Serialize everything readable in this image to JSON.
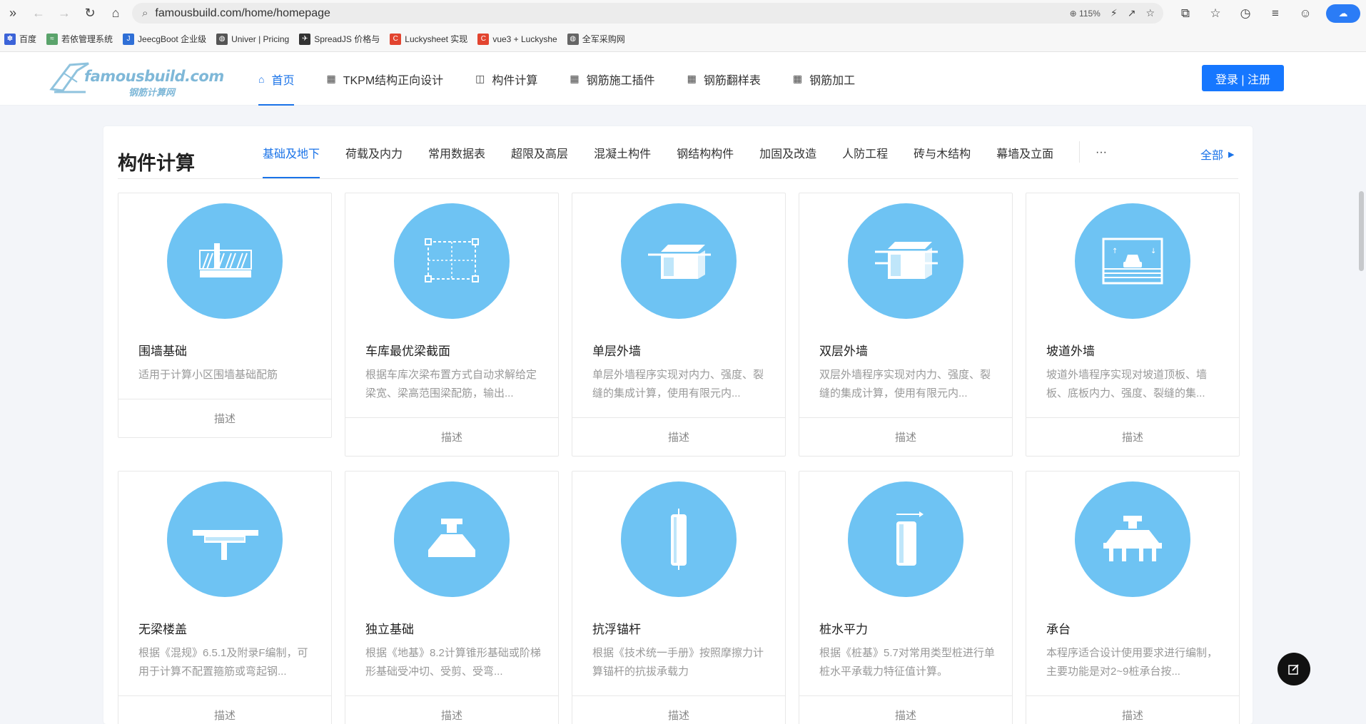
{
  "browser": {
    "url": "famousbuild.com/home/homepage",
    "zoom": "115%"
  },
  "bookmarks": [
    {
      "label": "百度",
      "color": "#3b63d8"
    },
    {
      "label": "若依管理系统",
      "color": "#5aa36b"
    },
    {
      "label": "JeecgBoot 企业级",
      "color": "#2f6fd6"
    },
    {
      "label": "Univer | Pricing",
      "color": "#555555"
    },
    {
      "label": "SpreadJS 价格与",
      "color": "#333333"
    },
    {
      "label": "Luckysheet 实现",
      "color": "#e2442f"
    },
    {
      "label": "vue3 + Luckyshe",
      "color": "#e2442f"
    },
    {
      "label": "全军采购网",
      "color": "#666666"
    }
  ],
  "site": {
    "logo_text": "famousbuild.com",
    "logo_sub": "钢筋计算网",
    "nav": [
      {
        "label": "首页",
        "icon": "home-icon",
        "active": true
      },
      {
        "label": "TKPM结构正向设计",
        "icon": "grid-icon"
      },
      {
        "label": "构件计算",
        "icon": "frame-icon"
      },
      {
        "label": "钢筋施工插件",
        "icon": "grid-icon"
      },
      {
        "label": "钢筋翻样表",
        "icon": "grid-icon"
      },
      {
        "label": "钢筋加工",
        "icon": "grid-icon"
      }
    ],
    "login_label": "登录 | 注册"
  },
  "panel": {
    "title": "构件计算",
    "tabs": [
      "基础及地下",
      "荷载及内力",
      "常用数据表",
      "超限及高层",
      "混凝土构件",
      "钢结构构件",
      "加固及改造",
      "人防工程",
      "砖与木结构",
      "幕墙及立面"
    ],
    "active_tab": 0,
    "more_label": "···",
    "all_label": "全部",
    "cards": [
      {
        "title": "围墙基础",
        "desc": "适用于计算小区围墙基础配筋",
        "foot": "描述",
        "icon": "wall-foundation-icon"
      },
      {
        "title": "车库最优梁截面",
        "desc": "根据车库次梁布置方式自动求解给定梁宽、梁高范围梁配筋，输出...",
        "foot": "描述",
        "icon": "beam-section-icon"
      },
      {
        "title": "单层外墙",
        "desc": "单层外墙程序实现对内力、强度、裂缝的集成计算，使用有限元内...",
        "foot": "描述",
        "icon": "single-wall-icon"
      },
      {
        "title": "双层外墙",
        "desc": "双层外墙程序实现对内力、强度、裂缝的集成计算，使用有限元内...",
        "foot": "描述",
        "icon": "double-wall-icon"
      },
      {
        "title": "坡道外墙",
        "desc": "坡道外墙程序实现对坡道顶板、墙板、底板内力、强度、裂缝的集...",
        "foot": "描述",
        "icon": "ramp-wall-icon"
      },
      {
        "title": "无梁楼盖",
        "desc": "根据《混规》6.5.1及附录F编制，可用于计算不配置箍筋或弯起钢...",
        "foot": "描述",
        "icon": "flat-slab-icon"
      },
      {
        "title": "独立基础",
        "desc": "根据《地基》8.2计算锥形基础或阶梯形基础受冲切、受剪、受弯...",
        "foot": "描述",
        "icon": "isolated-footing-icon"
      },
      {
        "title": "抗浮锚杆",
        "desc": "根据《技术统一手册》按照摩擦力计算锚杆的抗拔承载力",
        "foot": "描述",
        "icon": "anchor-rod-icon"
      },
      {
        "title": "桩水平力",
        "desc": "根据《桩基》5.7对常用类型桩进行单桩水平承载力特征值计算。",
        "foot": "描述",
        "icon": "pile-horizontal-icon"
      },
      {
        "title": "承台",
        "desc": "本程序适合设计使用要求进行编制，主要功能是对2~9桩承台按...",
        "foot": "描述",
        "icon": "pile-cap-icon"
      }
    ]
  }
}
